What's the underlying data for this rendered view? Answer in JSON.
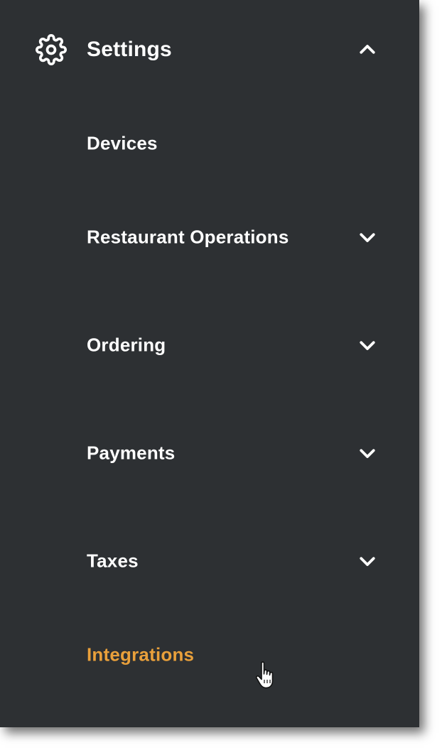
{
  "menu": {
    "header": {
      "label": "Settings",
      "icon": "gear-icon",
      "expanded": true
    },
    "items": [
      {
        "label": "Devices",
        "has_submenu": false
      },
      {
        "label": "Restaurant Operations",
        "has_submenu": true
      },
      {
        "label": "Ordering",
        "has_submenu": true
      },
      {
        "label": "Payments",
        "has_submenu": true
      },
      {
        "label": "Taxes",
        "has_submenu": true
      },
      {
        "label": "Integrations",
        "has_submenu": false,
        "active": true
      }
    ]
  },
  "colors": {
    "panel_bg": "#2d3033",
    "text": "#ffffff",
    "active_text": "#e9a03b"
  }
}
